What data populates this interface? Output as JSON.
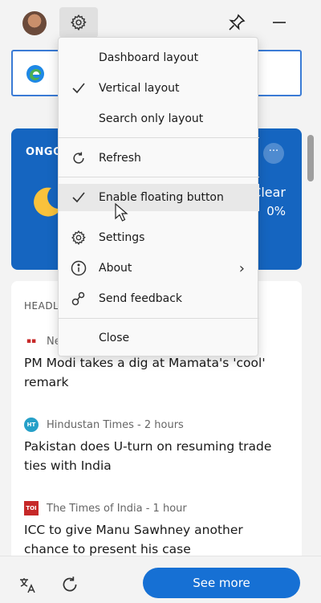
{
  "menu": {
    "items": [
      {
        "label": "Dashboard layout",
        "checked": false,
        "icon": ""
      },
      {
        "label": "Vertical layout",
        "checked": true,
        "icon": "checkmark-icon"
      },
      {
        "label": "Search only layout",
        "checked": false,
        "icon": ""
      },
      {
        "label": "Refresh",
        "icon": "refresh-icon"
      },
      {
        "label": "Enable floating button",
        "checked": true,
        "icon": "checkmark-icon"
      },
      {
        "label": "Settings",
        "icon": "gear-icon"
      },
      {
        "label": "About",
        "icon": "info-icon",
        "submenu": true
      },
      {
        "label": "Send feedback",
        "icon": "feedback-icon"
      },
      {
        "label": "Close",
        "icon": ""
      }
    ]
  },
  "weather": {
    "label": "ONGO",
    "condition": "Clear",
    "precip": "0%"
  },
  "news": {
    "section_label": "HEADL",
    "articles": [
      {
        "source": "Ne",
        "time": "",
        "headline": "PM Modi takes a dig at Mamata's 'cool' remark",
        "logo_color": "#c62828"
      },
      {
        "source": "Hindustan Times - 2 hours",
        "time": "2 hours",
        "headline": "Pakistan does U-turn on resuming trade ties with India",
        "logo_color": "#26a0c8",
        "logo_text": "HT"
      },
      {
        "source": "The Times of India - 1 hour",
        "time": "1 hour",
        "headline": "ICC to give Manu Sawhney another chance to present his case",
        "logo_color": "#c62828",
        "logo_text": "TOI"
      }
    ]
  },
  "bottom": {
    "see_more": "See more"
  },
  "colors": {
    "accent": "#1670d4",
    "weather_bg": "#1565c0",
    "search_border": "#3a7bd5"
  }
}
